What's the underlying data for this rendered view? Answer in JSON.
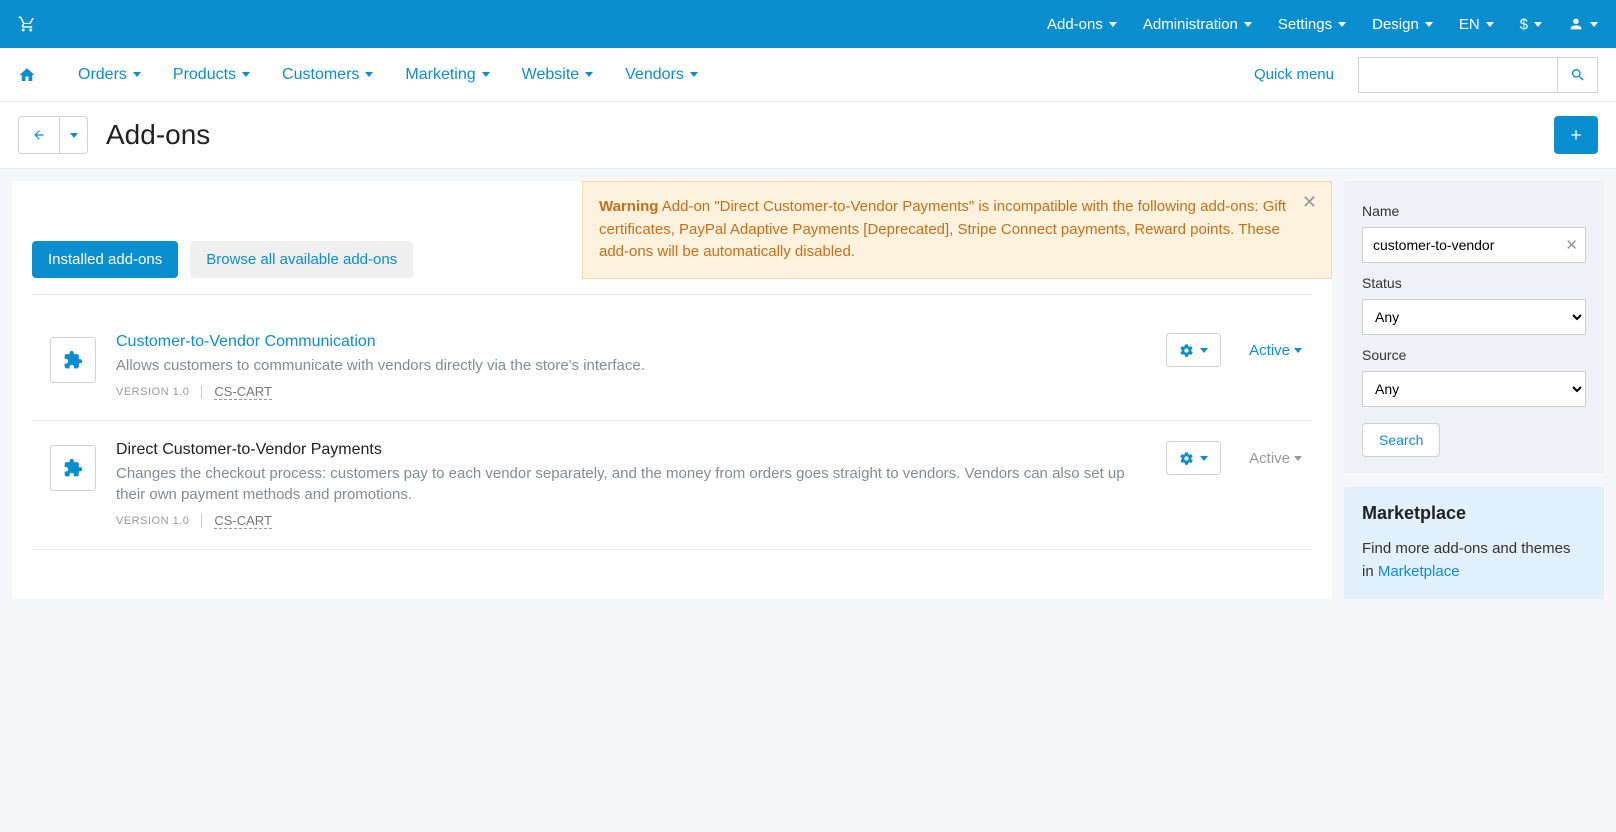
{
  "topbar": {
    "items": [
      "Add-ons",
      "Administration",
      "Settings",
      "Design",
      "EN",
      "$"
    ]
  },
  "navbar": {
    "items": [
      "Orders",
      "Products",
      "Customers",
      "Marketing",
      "Website",
      "Vendors"
    ],
    "quick_menu": "Quick menu"
  },
  "page": {
    "title": "Add-ons"
  },
  "warning": {
    "label": "Warning",
    "text": "Add-on \"Direct Customer-to-Vendor Payments\" is incompatible with the following add-ons: Gift certificates, PayPal Adaptive Payments [Deprecated], Stripe Connect payments, Reward points. These add-ons will be automatically disabled."
  },
  "tabs": {
    "installed": "Installed add-ons",
    "browse": "Browse all available add-ons"
  },
  "addons": [
    {
      "title": "Customer-to-Vendor Communication",
      "is_link": true,
      "desc": "Allows customers to communicate with vendors directly via the store's interface.",
      "version": "VERSION 1.0",
      "author": "CS-CART",
      "status": "Active",
      "status_enabled": true
    },
    {
      "title": "Direct Customer-to-Vendor Payments",
      "is_link": false,
      "desc": "Changes the checkout process: customers pay to each vendor separately, and the money from orders goes straight to vendors. Vendors can also set up their own payment methods and promotions.",
      "version": "VERSION 1.0",
      "author": "CS-CART",
      "status": "Active",
      "status_enabled": false
    }
  ],
  "sidebar": {
    "name_label": "Name",
    "name_value": "customer-to-vendor",
    "status_label": "Status",
    "status_value": "Any",
    "source_label": "Source",
    "source_value": "Any",
    "search_btn": "Search"
  },
  "marketplace": {
    "title": "Marketplace",
    "text_prefix": "Find more add-ons and themes in ",
    "link": "Marketplace"
  }
}
